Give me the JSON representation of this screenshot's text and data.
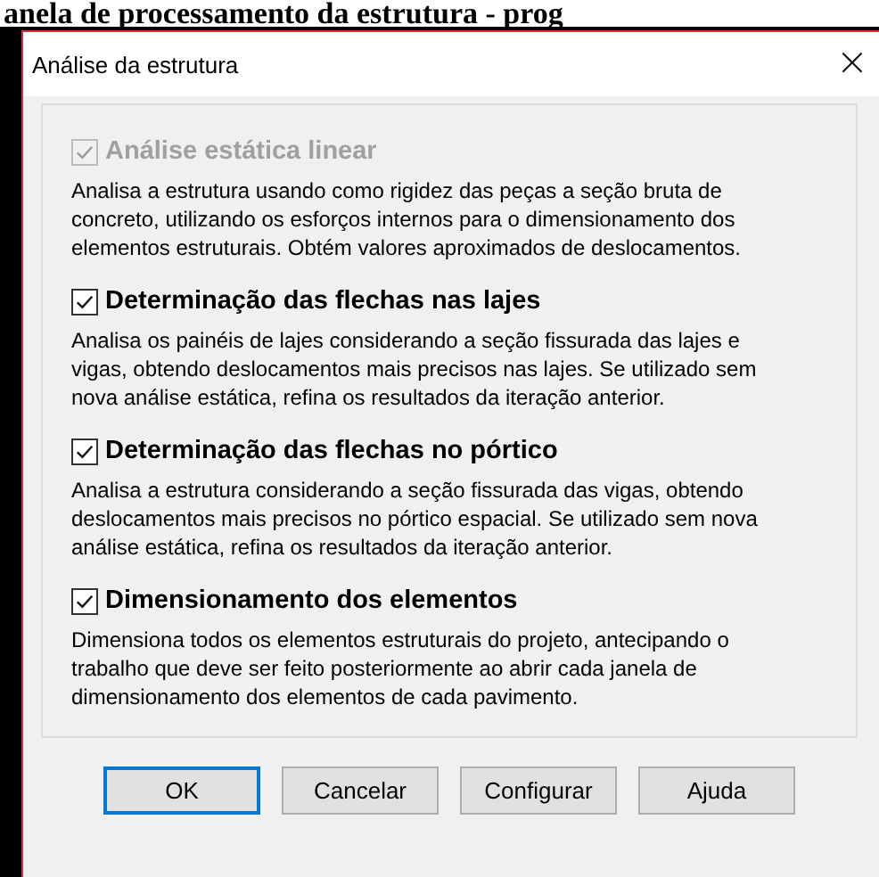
{
  "background_title": "anela de processamento da estrutura - prog",
  "dialog": {
    "title": "Análise da estrutura",
    "close": "×"
  },
  "options": [
    {
      "label": "Análise estática linear",
      "checked": true,
      "disabled": true,
      "description": "Analisa a estrutura usando como rigidez das peças a seção bruta de concreto, utilizando os esforços internos para o dimensionamento dos elementos estruturais. Obtém valores aproximados de deslocamentos."
    },
    {
      "label": "Determinação das flechas nas lajes",
      "checked": true,
      "disabled": false,
      "description": "Analisa os painéis de lajes considerando a seção fissurada das lajes e vigas, obtendo deslocamentos mais precisos nas lajes. Se utilizado sem nova análise estática, refina os resultados da iteração anterior."
    },
    {
      "label": "Determinação das flechas no pórtico",
      "checked": true,
      "disabled": false,
      "description": "Analisa a estrutura considerando a seção fissurada das vigas, obtendo deslocamentos mais precisos no pórtico espacial. Se utilizado sem nova análise estática, refina os resultados da iteração anterior."
    },
    {
      "label": "Dimensionamento dos elementos",
      "checked": true,
      "disabled": false,
      "description": "Dimensiona todos os elementos estruturais do projeto, antecipando o trabalho que deve ser feito posteriormente ao abrir cada janela de dimensionamento dos elementos de cada pavimento."
    }
  ],
  "buttons": [
    {
      "label": "OK",
      "default": true
    },
    {
      "label": "Cancelar",
      "default": false
    },
    {
      "label": "Configurar",
      "default": false
    },
    {
      "label": "Ajuda",
      "default": false
    }
  ]
}
